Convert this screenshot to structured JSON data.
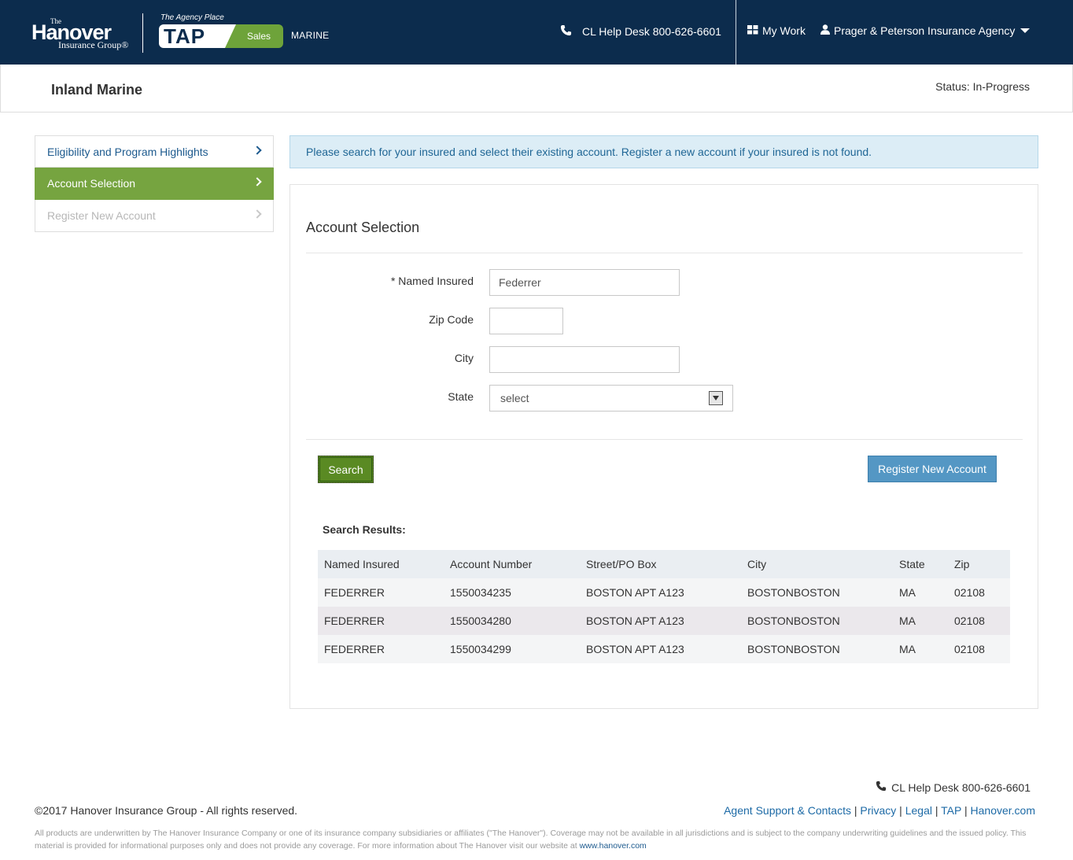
{
  "header": {
    "logo": {
      "the": "The",
      "name": "Hanover",
      "group": "Insurance Group®"
    },
    "tap": {
      "agency_place": "The Agency Place",
      "tap": "TAP",
      "sales": "Sales",
      "line": "MARINE"
    },
    "helpdesk": "CL Help Desk 800-626-6601",
    "mywork": "My Work",
    "agency": "Prager & Peterson Insurance Agency"
  },
  "page": {
    "title": "Inland Marine",
    "status": "Status: In-Progress"
  },
  "sidebar": {
    "items": [
      {
        "label": "Eligibility and Program Highlights",
        "state": "link"
      },
      {
        "label": "Account Selection",
        "state": "active"
      },
      {
        "label": "Register New Account",
        "state": "disabled"
      }
    ]
  },
  "alert": "Please search for your insured and select their existing account. Register a new account if your insured is not found.",
  "form": {
    "title": "Account Selection",
    "named_insured": {
      "label": "* Named Insured",
      "value": "Federrer"
    },
    "zip": {
      "label": "Zip Code",
      "value": ""
    },
    "city": {
      "label": "City",
      "value": ""
    },
    "state": {
      "label": "State",
      "value": "select"
    },
    "search_label": "Search",
    "register_label": "Register New Account"
  },
  "results": {
    "label": "Search Results:",
    "headers": [
      "Named Insured",
      "Account Number",
      "Street/PO Box",
      "City",
      "State",
      "Zip"
    ],
    "rows": [
      [
        "FEDERRER",
        "1550034235",
        "BOSTON APT A123",
        "BOSTONBOSTON",
        "MA",
        "02108"
      ],
      [
        "FEDERRER",
        "1550034280",
        "BOSTON APT A123",
        "BOSTONBOSTON",
        "MA",
        "02108"
      ],
      [
        "FEDERRER",
        "1550034299",
        "BOSTON APT A123",
        "BOSTONBOSTON",
        "MA",
        "02108"
      ]
    ]
  },
  "footer": {
    "helpdesk": "CL Help Desk 800-626-6601",
    "copyright": "©2017 Hanover Insurance Group - All rights reserved.",
    "links": [
      "Agent Support & Contacts",
      "Privacy",
      "Legal",
      "TAP",
      "Hanover.com"
    ],
    "disclaimer": "All products are underwritten by The Hanover Insurance Company or one of its insurance company subsidiaries or affiliates (\"The Hanover\"). Coverage may not be available in all jurisdictions and is subject to the company underwriting guidelines and the issued policy. This material is provided for informational purposes only and does not provide any coverage. For more information about The Hanover visit our website at",
    "disclaimer_link": "www.hanover.com"
  },
  "colors": {
    "header_bg": "#0c2c4d",
    "active_green": "#76a440",
    "search_green": "#5a8a23",
    "register_blue": "#5497c4",
    "alert_bg": "#dcedf6",
    "link_blue": "#1d5a8e"
  },
  "icons": [
    "phone-icon",
    "grid-icon",
    "user-icon",
    "caret-down-icon",
    "chevron-right-icon",
    "select-arrow-icon"
  ]
}
